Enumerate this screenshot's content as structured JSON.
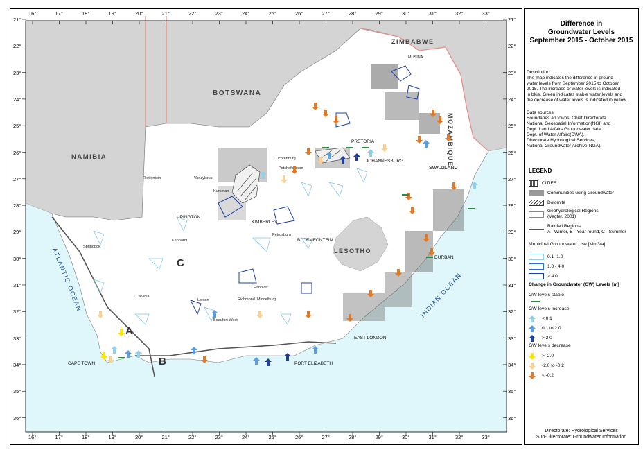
{
  "legend": {
    "title_lines": [
      "Difference in",
      "Groundwater Levels",
      "September 2015 -  October 2015"
    ],
    "description": "Description:\nThe map indicates the difference in ground-\nwater levels from September 2015 to October\n2015. The increase of water levels is indicated\nin blue. Green indicates stable water levels and\nthe decrease of water levels is indicated in yellow.",
    "sources": "Data sources:\nBoundaries an towns: Chief Directorate\nNational Geospatial Information(NGI) and\nDept. Land Affairs.Groundwater data:\nDept. of Water Affairs(DWA).\nDirectorate Hydrological Services,\nNational Groundwater Archive(NGA).",
    "heading": "LEGEND",
    "items": {
      "cities": "CITIES",
      "communities": "Communities using Groundwater",
      "dolomite": "Dolomite",
      "geohydro": "Geohydrological Regions\n(Vegter, 2001)",
      "rainfall": "Rainfall Regions\nA - Winter, B - Year round, C - Summer"
    },
    "municipal_heading": "Municipal Groundwater Use [Mm3/a]",
    "municipal_items": [
      "0.1 -1.0",
      "1.0 - 4.0",
      "> 4.0"
    ],
    "change_heading": "Change in Groundwater (GW) Levels [m]",
    "stable_label": "GW levels stable",
    "increase_label": "GW levels increase",
    "increase_items": [
      "< 0.1",
      "0.1 to 2.0",
      "> 2.0"
    ],
    "decrease_label": "GW levels decrease",
    "decrease_items": [
      "> -2.0",
      "-2.0 to -0.2",
      "< -0.2"
    ],
    "credit": "Directorate: Hydrological Services\nSub-Directorate: Groundwater Information"
  },
  "axes": {
    "longitude_labels": [
      "16°",
      "17°",
      "18°",
      "19°",
      "20°",
      "21°",
      "22°",
      "23°",
      "24°",
      "25°",
      "26°",
      "27°",
      "28°",
      "29°",
      "30°",
      "31°",
      "32°",
      "33°"
    ],
    "latitude_labels": [
      "21°",
      "22°",
      "23°",
      "24°",
      "25°",
      "26°",
      "27°",
      "28°",
      "29°",
      "30°",
      "31°",
      "32°",
      "33°",
      "34°",
      "35°",
      "36°"
    ]
  },
  "countries": {
    "zimbabwe": "ZIMBABWE",
    "botswana": "BOTSWANA",
    "mozambique": "MOZAMBIQUE",
    "namibia": "NAMIBIA",
    "swaziland": "SWAZILAND",
    "lesotho": "LESOTHO"
  },
  "oceans": {
    "atlantic": "ATLANTIC OCEAN",
    "indian": "INDIAN OCEAN"
  },
  "regions": {
    "a": "A",
    "b": "B",
    "c": "C"
  },
  "towns": {
    "musina": "MUSINA",
    "pretoria": "PRETORIA",
    "johannesburg": "JOHANNESBURG",
    "lichtenburg": "Lichtenburg",
    "potchefstroom": "Potchefstroom",
    "rietfontein": "Rietfontein",
    "vanzylsrus": "Vanzylsrus",
    "kuruman": "Kuruman",
    "upington": "UPINGTON",
    "kimberley": "KIMBERLEY",
    "petrusburg": "Petrusburg",
    "bloemfontein": "BLOEMFONTEIN",
    "kenhardt": "Kenhardt",
    "springbok": "Springbok",
    "durban": "DURBAN",
    "hanover": "Hanover",
    "richmond": "Richmond",
    "middelburg": "Middelburg",
    "calvinia": "Calvinia",
    "loxton": "Loxton",
    "beaufort_west": "Beaufort West",
    "east_london": "EAST LONDON",
    "cape_town": "CAPE TOWN",
    "port_elizabeth": "PORT ELIZABETH"
  },
  "colors": {
    "ocean": "#dff7fb",
    "neighbour": "#d4d4d4",
    "border": "#e8908e",
    "increase_light": "#8fd1ef",
    "increase_mid": "#5b9ee6",
    "increase_dark": "#1f3fa3",
    "decrease_yellow": "#ffe600",
    "decrease_light": "#f8cf96",
    "decrease_orange": "#e07a2a",
    "stable": "#2e8b3d"
  }
}
